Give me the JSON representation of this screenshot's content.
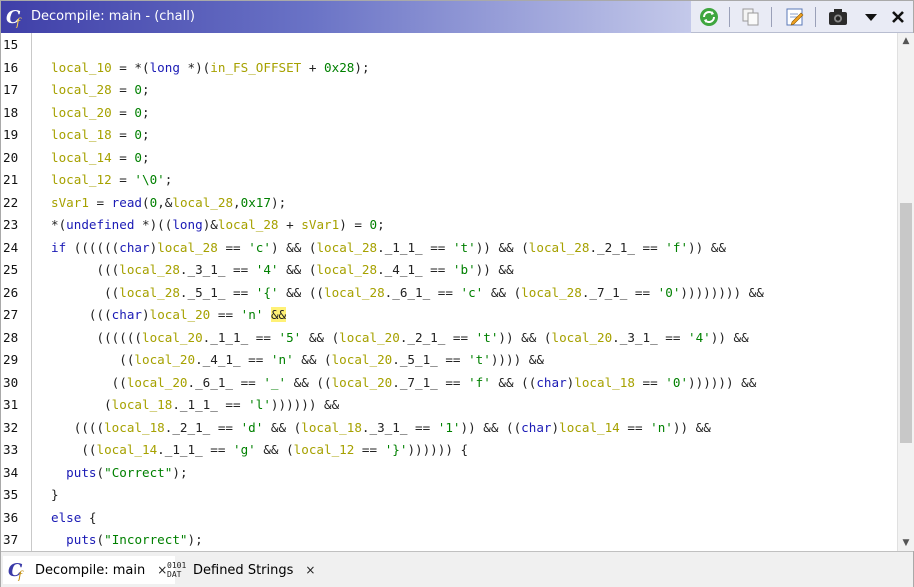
{
  "window": {
    "title": "Decompile: main -  (chall)"
  },
  "toolbar": {
    "buttons": [
      {
        "name": "refresh-icon"
      },
      {
        "name": "copy-icon"
      },
      {
        "name": "edit-function-signature-icon"
      },
      {
        "name": "snapshot-icon"
      },
      {
        "name": "menu-dropdown-icon"
      },
      {
        "name": "close-icon"
      }
    ]
  },
  "code": {
    "lines": [
      {
        "n": "15",
        "text": ""
      },
      {
        "n": "16",
        "text": "  local_10 = *(long *)(in_FS_OFFSET + 0x28);"
      },
      {
        "n": "17",
        "text": "  local_28 = 0;"
      },
      {
        "n": "18",
        "text": "  local_20 = 0;"
      },
      {
        "n": "19",
        "text": "  local_18 = 0;"
      },
      {
        "n": "20",
        "text": "  local_14 = 0;"
      },
      {
        "n": "21",
        "text": "  local_12 = '\\0';"
      },
      {
        "n": "22",
        "text": "  sVar1 = read(0,&local_28,0x17);"
      },
      {
        "n": "23",
        "text": "  *(undefined *)((long)&local_28 + sVar1) = 0;"
      },
      {
        "n": "24",
        "text": "  if ((((((char)local_28 == 'c') && (local_28._1_1_ == 't')) && (local_28._2_1_ == 'f')) &&"
      },
      {
        "n": "25",
        "text": "        (((local_28._3_1_ == '4' && (local_28._4_1_ == 'b')) &&"
      },
      {
        "n": "26",
        "text": "         ((local_28._5_1_ == '{' && ((local_28._6_1_ == 'c' && (local_28._7_1_ == '0')))))))) &&"
      },
      {
        "n": "27",
        "text": "       (((char)local_20 == 'n' &&"
      },
      {
        "n": "28",
        "text": "        ((((((local_20._1_1_ == '5' && (local_20._2_1_ == 't')) && (local_20._3_1_ == '4')) &&"
      },
      {
        "n": "29",
        "text": "           ((local_20._4_1_ == 'n' && (local_20._5_1_ == 't')))) &&"
      },
      {
        "n": "30",
        "text": "          ((local_20._6_1_ == '_' && ((local_20._7_1_ == 'f' && ((char)local_18 == '0')))))) &&"
      },
      {
        "n": "31",
        "text": "         (local_18._1_1_ == 'l')))))) &&"
      },
      {
        "n": "32",
        "text": "     ((((local_18._2_1_ == 'd' && (local_18._3_1_ == '1')) && ((char)local_14 == 'n')) &&"
      },
      {
        "n": "33",
        "text": "      ((local_14._1_1_ == 'g' && (local_12 == '}')))))) {"
      },
      {
        "n": "34",
        "text": "    puts(\"Correct\");"
      },
      {
        "n": "35",
        "text": "  }"
      },
      {
        "n": "36",
        "text": "  else {"
      },
      {
        "n": "37",
        "text": "    puts(\"Incorrect\");"
      }
    ]
  },
  "tabs": [
    {
      "label": "Decompile: main",
      "close": "×",
      "icon": "decompiler-icon",
      "active": true
    },
    {
      "label": "Defined Strings",
      "close": "×",
      "icon": "dat-icon",
      "icon_text_top": "0101",
      "icon_text_bottom": "DAT",
      "active": false
    }
  ],
  "colors": {
    "title_gradient_start": "#3f3fa8",
    "variable": "#a6a100",
    "keyword": "#1a1ab5",
    "literal": "#008000",
    "highlight": "#fff176"
  }
}
